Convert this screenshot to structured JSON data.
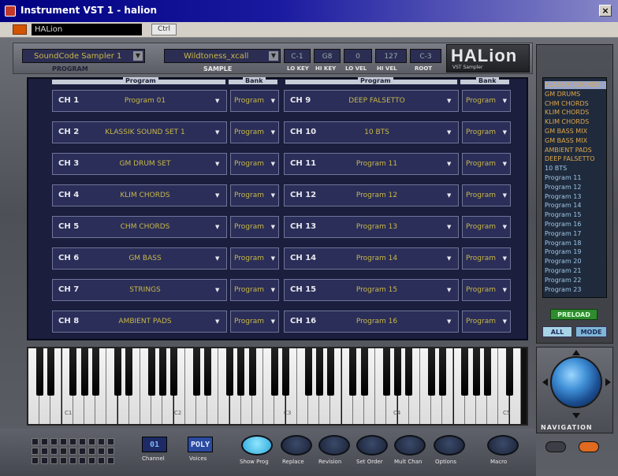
{
  "window": {
    "title": "Instrument VST 1 - halion",
    "close_symbol": "×"
  },
  "host": {
    "preset": "HALion",
    "menu": "Ctrl"
  },
  "header": {
    "program_select": "SoundCode Sampler 1",
    "program_label": "PROGRAM",
    "sample_select": "Wildtoness_xcall",
    "sample_label": "SAMPLE",
    "params": [
      "C-1",
      "G8",
      "0",
      "127",
      "C-3"
    ],
    "param_labels": [
      "LO KEY",
      "HI KEY",
      "LO VEL",
      "HI VEL",
      "ROOT"
    ],
    "logo": "HALion",
    "logo_sub": "VST Sampler"
  },
  "columns": {
    "program": "Program",
    "bank": "Bank"
  },
  "channels_left": [
    {
      "ch": "CH 1",
      "program": "Program 01",
      "bank": "Program"
    },
    {
      "ch": "CH 2",
      "program": "KLASSIK SOUND SET 1",
      "bank": "Program"
    },
    {
      "ch": "CH 3",
      "program": "GM DRUM SET",
      "bank": "Program"
    },
    {
      "ch": "CH 4",
      "program": "KLIM CHORDS",
      "bank": "Program"
    },
    {
      "ch": "CH 5",
      "program": "CHM CHORDS",
      "bank": "Program"
    },
    {
      "ch": "CH 6",
      "program": "GM BASS",
      "bank": "Program"
    },
    {
      "ch": "CH 7",
      "program": "STRINGS",
      "bank": "Program"
    },
    {
      "ch": "CH 8",
      "program": "AMBIENT PADS",
      "bank": "Program"
    }
  ],
  "channels_right": [
    {
      "ch": "CH 9",
      "program": "DEEP FALSETTO",
      "bank": "Program"
    },
    {
      "ch": "CH 10",
      "program": "10 BTS",
      "bank": "Program"
    },
    {
      "ch": "CH 11",
      "program": "Program 11",
      "bank": "Program"
    },
    {
      "ch": "CH 12",
      "program": "Program 12",
      "bank": "Program"
    },
    {
      "ch": "CH 13",
      "program": "Program 13",
      "bank": "Program"
    },
    {
      "ch": "CH 14",
      "program": "Program 14",
      "bank": "Program"
    },
    {
      "ch": "CH 15",
      "program": "Program 15",
      "bank": "Program"
    },
    {
      "ch": "CH 16",
      "program": "Program 16",
      "bank": "Program"
    }
  ],
  "preset_list": [
    "KLASSIK SOUNDS",
    "GM DRUMS",
    "CHM CHORDS",
    "KLIM CHORDS",
    "KLIM CHORDS",
    "GM BASS MIX",
    "GM BASS MIX",
    "AMBIENT PADS",
    "DEEP FALSETTO",
    "10 BTS",
    "Program 11",
    "Program 12",
    "Program 13",
    "Program 14",
    "Program 15",
    "Program 16",
    "Program 17",
    "Program 18",
    "Program 19",
    "Program 20",
    "Program 21",
    "Program 22",
    "Program 23"
  ],
  "preset_panel": {
    "load_label": "PRELOAD",
    "btn_all": "ALL",
    "btn_mode": "MODE"
  },
  "keyboard": {
    "octave_labels": [
      "C1",
      "C2",
      "C3",
      "C4",
      "C5"
    ]
  },
  "navigation": {
    "label": "NAVIGATION"
  },
  "bottom": {
    "lcd_channel": "01",
    "lcd_channel_label": "Channel",
    "lcd_poly": "POLY",
    "lcd_poly_label": "Voices",
    "buttons": [
      "Show Prog",
      "Replace",
      "Revision",
      "Set Order",
      "Mult Chan",
      "Options",
      "Macro"
    ]
  },
  "colors": {
    "accent": "#c9b74a",
    "panel": "#1b1e3d",
    "title_bar": "#000080"
  }
}
